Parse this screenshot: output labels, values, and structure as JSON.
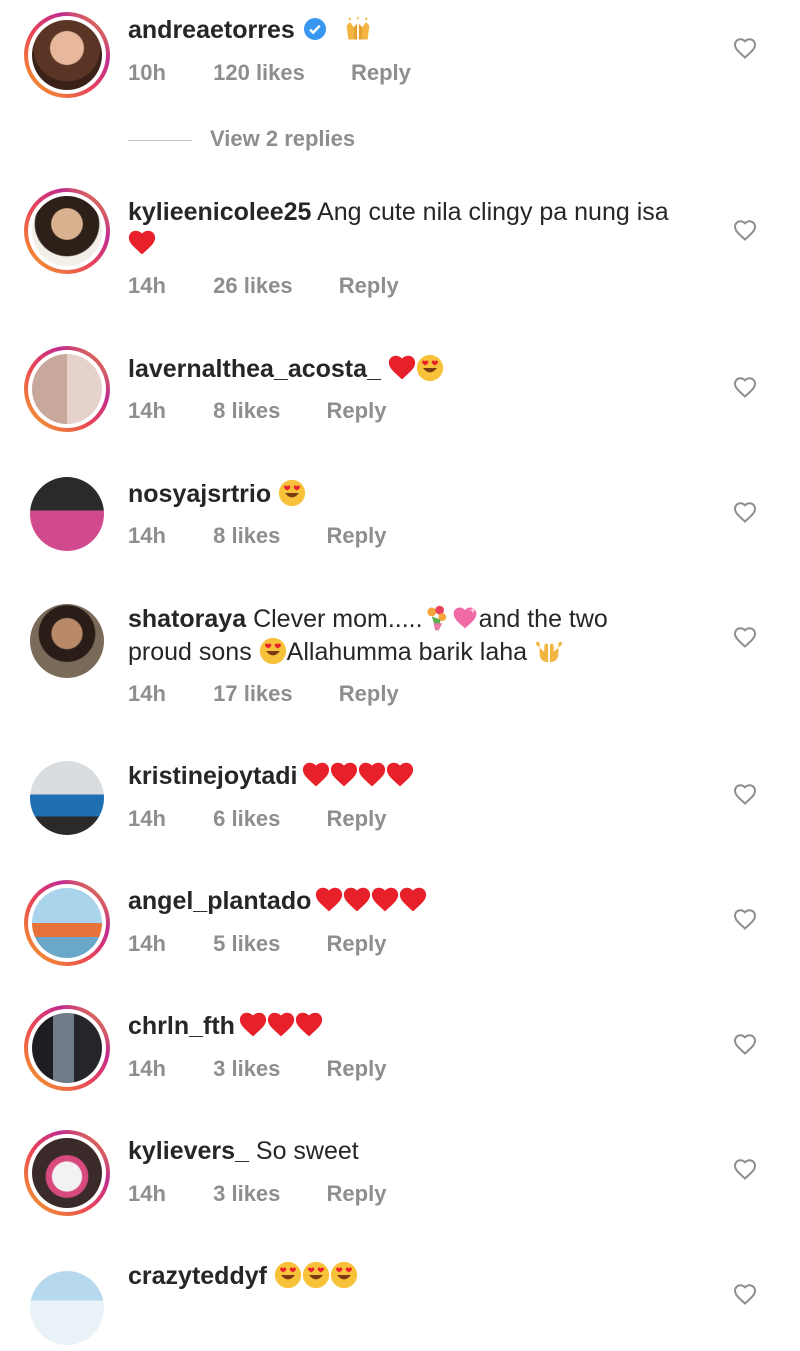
{
  "comments": [
    {
      "username": "andreaetorres",
      "text": "",
      "time": "10h",
      "likes": "120 likes",
      "reply": "Reply",
      "verified": true,
      "emoji": [
        "raised-hands"
      ]
    },
    {
      "username": "kylieenicolee25",
      "text": "Ang cute nila clingy pa nung isa",
      "time": "14h",
      "likes": "26 likes",
      "reply": "Reply",
      "emoji": [
        "red-heart"
      ]
    },
    {
      "username": "lavernalthea_acosta_",
      "text": "",
      "time": "14h",
      "likes": "8 likes",
      "reply": "Reply",
      "emoji": [
        "red-heart",
        "heart-eyes"
      ]
    },
    {
      "username": "nosyajsrtrio",
      "text": "",
      "time": "14h",
      "likes": "8 likes",
      "reply": "Reply",
      "emoji": [
        "heart-eyes"
      ]
    },
    {
      "username": "shatoraya",
      "text1": "Clever mom.....",
      "text2": "and the two",
      "text3": "proud sons",
      "text4": "Allahumma barik laha",
      "time": "14h",
      "likes": "17 likes",
      "reply": "Reply",
      "emoji": [
        "bouquet",
        "sparkling-heart",
        "heart-eyes",
        "open-hands"
      ]
    },
    {
      "username": "kristinejoytadi",
      "text": "",
      "time": "14h",
      "likes": "6 likes",
      "reply": "Reply",
      "emoji": [
        "red-heart",
        "red-heart",
        "red-heart",
        "red-heart"
      ]
    },
    {
      "username": "angel_plantado",
      "text": "",
      "time": "14h",
      "likes": "5 likes",
      "reply": "Reply",
      "emoji": [
        "red-heart",
        "red-heart",
        "red-heart",
        "red-heart"
      ]
    },
    {
      "username": "chrln_fth",
      "text": "",
      "time": "14h",
      "likes": "3 likes",
      "reply": "Reply",
      "emoji": [
        "red-heart",
        "red-heart",
        "red-heart"
      ]
    },
    {
      "username": "kylievers_",
      "text": "So sweet",
      "time": "14h",
      "likes": "3 likes",
      "reply": "Reply",
      "emoji": []
    },
    {
      "username": "crazyteddyf",
      "text": "",
      "time": "",
      "likes": "",
      "reply": "",
      "emoji": [
        "heart-eyes",
        "heart-eyes",
        "heart-eyes"
      ]
    }
  ],
  "view_replies": "View 2 replies",
  "icons": {
    "like": "heart-outline-icon",
    "verified": "verified-badge-icon"
  },
  "colors": {
    "meta": "#8e8e8e",
    "text": "#262626",
    "heart_red": "#e8202a",
    "verified_blue": "#3897f0"
  }
}
